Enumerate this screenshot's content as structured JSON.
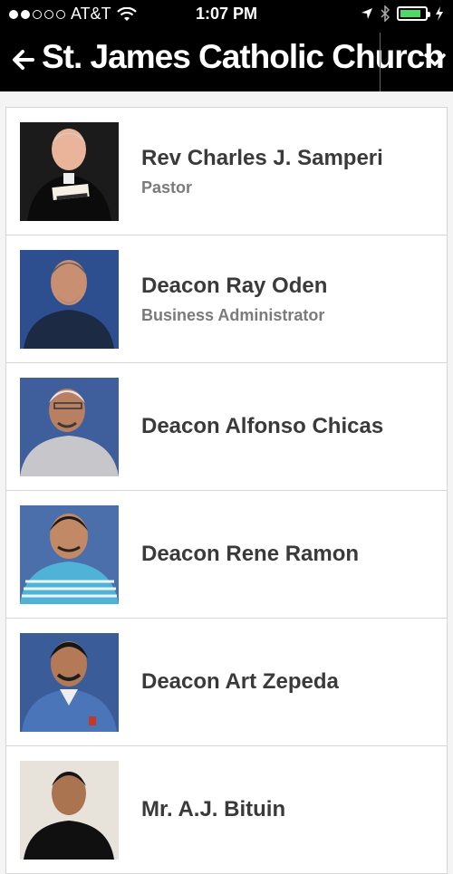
{
  "status_bar": {
    "carrier": "AT&T",
    "time": "1:07 PM",
    "signal_strength": 2,
    "battery_color": "#4cd964"
  },
  "nav": {
    "title": "St. James Catholic Church",
    "back_icon": "arrow-left-icon",
    "menu_icon": "chevron-down-icon"
  },
  "staff": [
    {
      "name": "Rev Charles J. Samperi",
      "role": "Pastor"
    },
    {
      "name": "Deacon Ray Oden",
      "role": "Business Administrator"
    },
    {
      "name": "Deacon Alfonso Chicas",
      "role": ""
    },
    {
      "name": "Deacon Rene Ramon",
      "role": ""
    },
    {
      "name": "Deacon Art Zepeda",
      "role": ""
    },
    {
      "name": "Mr. A.J. Bituin",
      "role": ""
    }
  ]
}
